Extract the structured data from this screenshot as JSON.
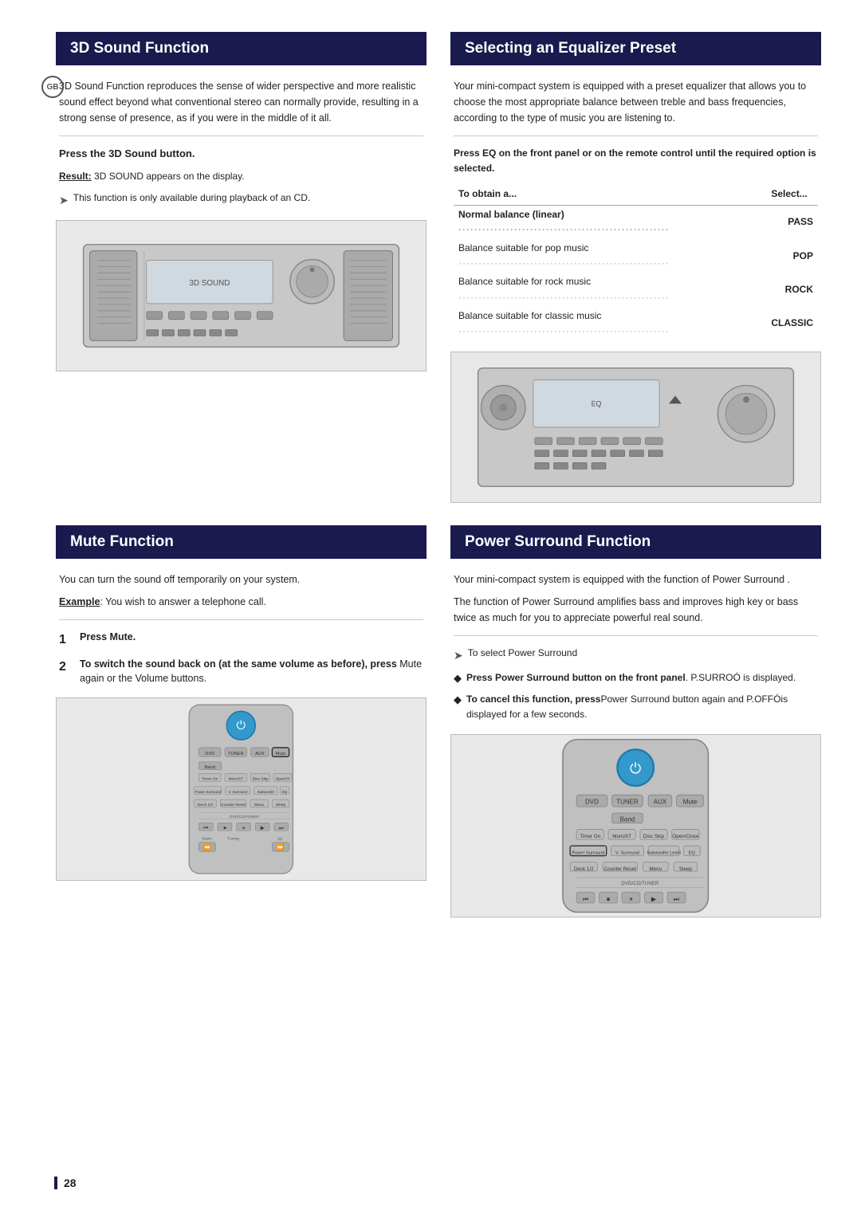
{
  "page": {
    "number": "28",
    "gb_label": "GB"
  },
  "section_3d": {
    "title": "3D Sound Function",
    "body": "3D Sound Function reproduces the sense of wider perspective and more realistic sound effect beyond what conventional stereo can normally provide, resulting in a strong sense of presence, as if you were in the middle of it all.",
    "divider": true,
    "press_button": "Press the 3D Sound  button.",
    "result_label": "Result:",
    "result_text": "3D SOUND appears on the display.",
    "tip": "This function is only available during playback of an CD."
  },
  "section_eq": {
    "title": "Selecting an Equalizer Preset",
    "body": "Your mini-compact system is equipped with a preset equalizer that allows you to choose the most appropriate balance between treble and bass frequencies, according to the type of music you are listening to.",
    "instruction_bold": "Press EQ on the front panel or on the remote control until the required option is selected.",
    "table_headers": [
      "To obtain a...",
      "Select..."
    ],
    "table_rows": [
      {
        "label": "Normal balance (linear)",
        "value": "PASS"
      },
      {
        "label": "Balance suitable for pop music",
        "value": "POP"
      },
      {
        "label": "Balance suitable for rock music",
        "value": "ROCK"
      },
      {
        "label": "Balance suitable for classic music",
        "value": "CLASSIC"
      }
    ]
  },
  "section_mute": {
    "title": "Mute Function",
    "body": "You can turn the sound off temporarily on your system.",
    "example_label": "Example",
    "example_text": ": You wish to answer a telephone call.",
    "divider": true,
    "steps": [
      {
        "num": "1",
        "bold": "Press Mute."
      },
      {
        "num": "2",
        "bold": "To switch the sound back on (at the same volume as before), press ",
        "text": "Mute again or the Volume  buttons."
      }
    ]
  },
  "section_surround": {
    "title": "Power Surround Function",
    "body1": "Your mini-compact system is equipped with the function of Power Surround .",
    "body2": "The function of Power Surround amplifies bass and improves high key or bass twice as much for you to appreciate powerful real sound.",
    "divider": true,
    "tip_label": "To select",
    "tip_text": " Power Surround",
    "bullet1_bold": "Press Power Surround  button on the front panel",
    "bullet1_text": ". P.SURROÓ is displayed.",
    "bullet2_bold": "To cancel this function, press",
    "bullet2_text": "Power Surround  button again and P.OFFÓis displayed for a few seconds."
  }
}
